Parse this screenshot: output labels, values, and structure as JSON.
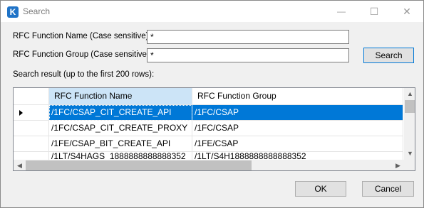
{
  "window": {
    "title": "Search",
    "icon_letter": "K",
    "controls": {
      "minimize": "—",
      "maximize": "☐",
      "close": "✕"
    }
  },
  "form": {
    "function_name_label": "RFC Function Name (Case sensitive):",
    "function_name_value": "*",
    "function_group_label": "RFC Function Group (Case sensitive):",
    "function_group_value": "*",
    "search_button": "Search",
    "result_label": "Search result (up to the first 200 rows):"
  },
  "grid": {
    "columns": [
      "RFC Function Name",
      "RFC Function Group"
    ],
    "rows": [
      {
        "name": "/1FC/CSAP_CIT_CREATE_API",
        "group": "/1FC/CSAP"
      },
      {
        "name": "/1FC/CSAP_CIT_CREATE_PROXY",
        "group": "/1FC/CSAP"
      },
      {
        "name": "/1FE/CSAP_BIT_CREATE_API",
        "group": "/1FE/CSAP"
      },
      {
        "name": "/1LT/S4HAGS_1888888888888352",
        "group": "/1LT/S4H1888888888888352"
      }
    ],
    "selected_row": 0
  },
  "footer": {
    "ok_button": "OK",
    "cancel_button": "Cancel"
  }
}
